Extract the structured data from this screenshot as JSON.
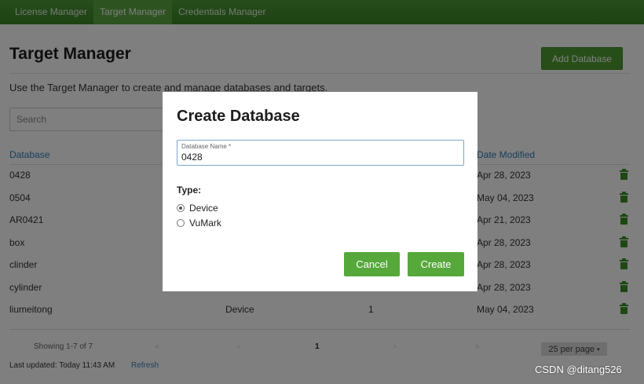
{
  "nav": {
    "tabs": [
      {
        "label": "License Manager"
      },
      {
        "label": "Target Manager"
      },
      {
        "label": "Credentials Manager"
      }
    ]
  },
  "page": {
    "title": "Target Manager",
    "add_button": "Add Database",
    "description": "Use the Target Manager to create and manage databases and targets.",
    "search_placeholder": "Search"
  },
  "table": {
    "columns": {
      "database": "Database",
      "date_modified": "Date Modified"
    },
    "rows": [
      {
        "name": "0428",
        "type": "",
        "count": "",
        "date": "Apr 28, 2023"
      },
      {
        "name": "0504",
        "type": "",
        "count": "",
        "date": "May 04, 2023"
      },
      {
        "name": "AR0421",
        "type": "",
        "count": "",
        "date": "Apr 21, 2023"
      },
      {
        "name": "box",
        "type": "",
        "count": "",
        "date": "Apr 28, 2023"
      },
      {
        "name": "clinder",
        "type": "",
        "count": "",
        "date": "Apr 28, 2023"
      },
      {
        "name": "cylinder",
        "type": "",
        "count": "",
        "date": "Apr 28, 2023"
      },
      {
        "name": "liumeitong",
        "type": "Device",
        "count": "1",
        "date": "May 04, 2023"
      }
    ]
  },
  "pagination": {
    "showing": "Showing 1-7 of 7",
    "first": "«",
    "prev": "‹",
    "page": "1",
    "next": "›",
    "last": "»",
    "per_page_count": "25",
    "per_page_label": "per page",
    "caret": "▾"
  },
  "footer": {
    "last_updated": "Last updated: Today 11:43 AM",
    "refresh": "Refresh",
    "watermark": "CSDN @ditang526"
  },
  "modal": {
    "title": "Create Database",
    "field_label": "Database Name *",
    "field_value": "0428",
    "type_label": "Type:",
    "options": [
      {
        "label": "Device",
        "checked": true
      },
      {
        "label": "VuMark",
        "checked": false
      }
    ],
    "cancel": "Cancel",
    "create": "Create"
  },
  "colors": {
    "brand_green": "#4f9c32",
    "link_blue": "#2f7fb8",
    "trash_green": "#3d8f29"
  }
}
